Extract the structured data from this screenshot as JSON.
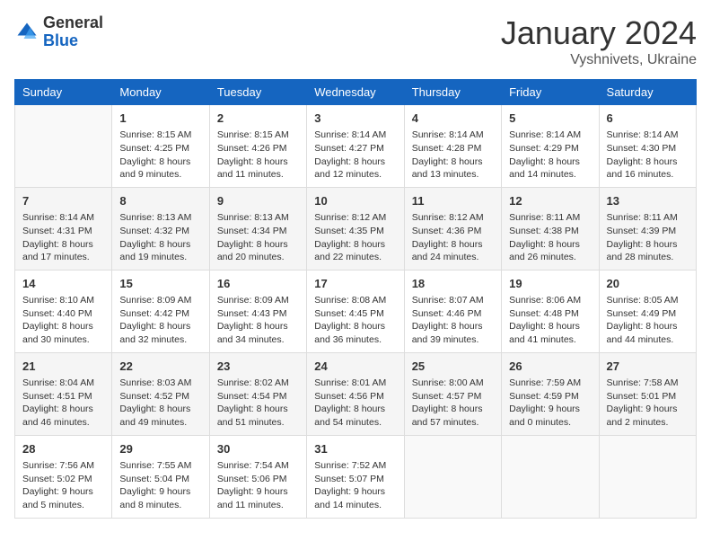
{
  "header": {
    "logo_general": "General",
    "logo_blue": "Blue",
    "month_title": "January 2024",
    "location": "Vyshnivets, Ukraine"
  },
  "weekdays": [
    "Sunday",
    "Monday",
    "Tuesday",
    "Wednesday",
    "Thursday",
    "Friday",
    "Saturday"
  ],
  "weeks": [
    [
      {
        "day": "",
        "info": ""
      },
      {
        "day": "1",
        "info": "Sunrise: 8:15 AM\nSunset: 4:25 PM\nDaylight: 8 hours\nand 9 minutes."
      },
      {
        "day": "2",
        "info": "Sunrise: 8:15 AM\nSunset: 4:26 PM\nDaylight: 8 hours\nand 11 minutes."
      },
      {
        "day": "3",
        "info": "Sunrise: 8:14 AM\nSunset: 4:27 PM\nDaylight: 8 hours\nand 12 minutes."
      },
      {
        "day": "4",
        "info": "Sunrise: 8:14 AM\nSunset: 4:28 PM\nDaylight: 8 hours\nand 13 minutes."
      },
      {
        "day": "5",
        "info": "Sunrise: 8:14 AM\nSunset: 4:29 PM\nDaylight: 8 hours\nand 14 minutes."
      },
      {
        "day": "6",
        "info": "Sunrise: 8:14 AM\nSunset: 4:30 PM\nDaylight: 8 hours\nand 16 minutes."
      }
    ],
    [
      {
        "day": "7",
        "info": "Sunrise: 8:14 AM\nSunset: 4:31 PM\nDaylight: 8 hours\nand 17 minutes."
      },
      {
        "day": "8",
        "info": "Sunrise: 8:13 AM\nSunset: 4:32 PM\nDaylight: 8 hours\nand 19 minutes."
      },
      {
        "day": "9",
        "info": "Sunrise: 8:13 AM\nSunset: 4:34 PM\nDaylight: 8 hours\nand 20 minutes."
      },
      {
        "day": "10",
        "info": "Sunrise: 8:12 AM\nSunset: 4:35 PM\nDaylight: 8 hours\nand 22 minutes."
      },
      {
        "day": "11",
        "info": "Sunrise: 8:12 AM\nSunset: 4:36 PM\nDaylight: 8 hours\nand 24 minutes."
      },
      {
        "day": "12",
        "info": "Sunrise: 8:11 AM\nSunset: 4:38 PM\nDaylight: 8 hours\nand 26 minutes."
      },
      {
        "day": "13",
        "info": "Sunrise: 8:11 AM\nSunset: 4:39 PM\nDaylight: 8 hours\nand 28 minutes."
      }
    ],
    [
      {
        "day": "14",
        "info": "Sunrise: 8:10 AM\nSunset: 4:40 PM\nDaylight: 8 hours\nand 30 minutes."
      },
      {
        "day": "15",
        "info": "Sunrise: 8:09 AM\nSunset: 4:42 PM\nDaylight: 8 hours\nand 32 minutes."
      },
      {
        "day": "16",
        "info": "Sunrise: 8:09 AM\nSunset: 4:43 PM\nDaylight: 8 hours\nand 34 minutes."
      },
      {
        "day": "17",
        "info": "Sunrise: 8:08 AM\nSunset: 4:45 PM\nDaylight: 8 hours\nand 36 minutes."
      },
      {
        "day": "18",
        "info": "Sunrise: 8:07 AM\nSunset: 4:46 PM\nDaylight: 8 hours\nand 39 minutes."
      },
      {
        "day": "19",
        "info": "Sunrise: 8:06 AM\nSunset: 4:48 PM\nDaylight: 8 hours\nand 41 minutes."
      },
      {
        "day": "20",
        "info": "Sunrise: 8:05 AM\nSunset: 4:49 PM\nDaylight: 8 hours\nand 44 minutes."
      }
    ],
    [
      {
        "day": "21",
        "info": "Sunrise: 8:04 AM\nSunset: 4:51 PM\nDaylight: 8 hours\nand 46 minutes."
      },
      {
        "day": "22",
        "info": "Sunrise: 8:03 AM\nSunset: 4:52 PM\nDaylight: 8 hours\nand 49 minutes."
      },
      {
        "day": "23",
        "info": "Sunrise: 8:02 AM\nSunset: 4:54 PM\nDaylight: 8 hours\nand 51 minutes."
      },
      {
        "day": "24",
        "info": "Sunrise: 8:01 AM\nSunset: 4:56 PM\nDaylight: 8 hours\nand 54 minutes."
      },
      {
        "day": "25",
        "info": "Sunrise: 8:00 AM\nSunset: 4:57 PM\nDaylight: 8 hours\nand 57 minutes."
      },
      {
        "day": "26",
        "info": "Sunrise: 7:59 AM\nSunset: 4:59 PM\nDaylight: 9 hours\nand 0 minutes."
      },
      {
        "day": "27",
        "info": "Sunrise: 7:58 AM\nSunset: 5:01 PM\nDaylight: 9 hours\nand 2 minutes."
      }
    ],
    [
      {
        "day": "28",
        "info": "Sunrise: 7:56 AM\nSunset: 5:02 PM\nDaylight: 9 hours\nand 5 minutes."
      },
      {
        "day": "29",
        "info": "Sunrise: 7:55 AM\nSunset: 5:04 PM\nDaylight: 9 hours\nand 8 minutes."
      },
      {
        "day": "30",
        "info": "Sunrise: 7:54 AM\nSunset: 5:06 PM\nDaylight: 9 hours\nand 11 minutes."
      },
      {
        "day": "31",
        "info": "Sunrise: 7:52 AM\nSunset: 5:07 PM\nDaylight: 9 hours\nand 14 minutes."
      },
      {
        "day": "",
        "info": ""
      },
      {
        "day": "",
        "info": ""
      },
      {
        "day": "",
        "info": ""
      }
    ]
  ]
}
